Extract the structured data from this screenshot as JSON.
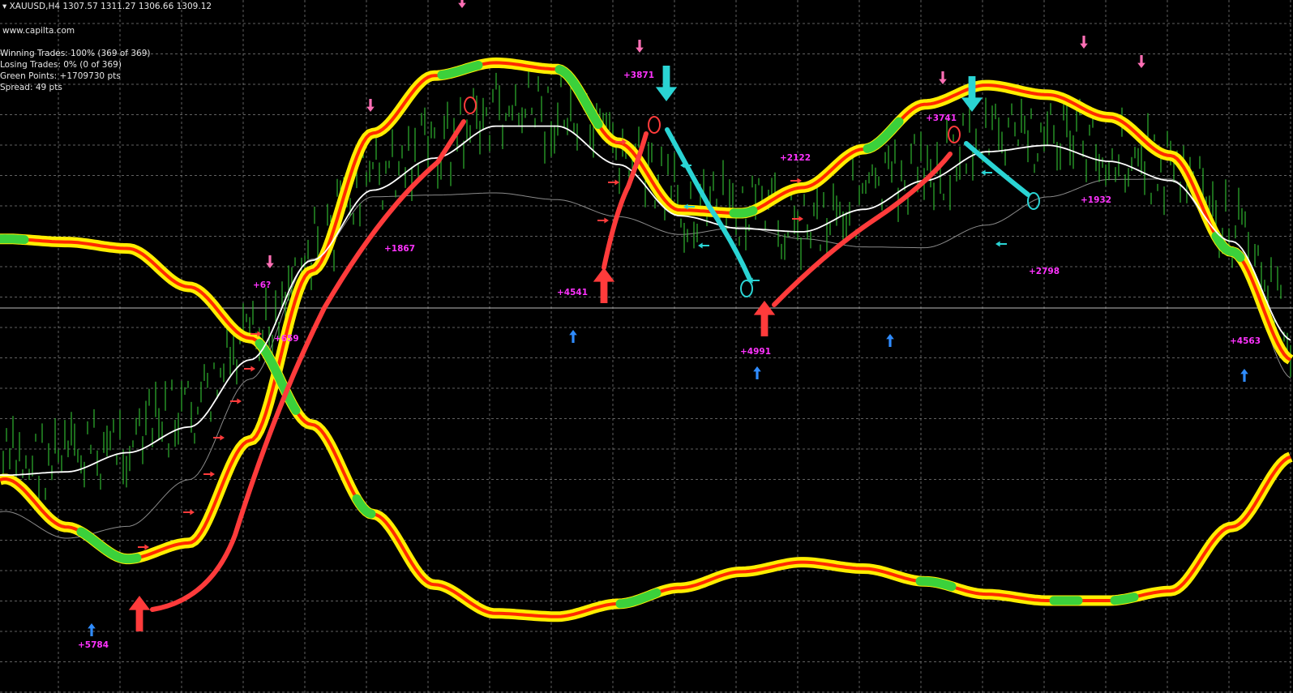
{
  "header": {
    "symbol_line": "▾ XAUUSD,H4  1307.57 1311.27 1306.66 1309.12",
    "website": "www.capilta.com"
  },
  "stats": {
    "winning": "Winning Trades: 100% (369 of 369)",
    "losing": "Losing Trades: 0% (0 of 369)",
    "green_points": "Green Points: +1709730 pts",
    "spread": "Spread: 49 pts"
  },
  "colors": {
    "background": "#000000",
    "grid": "#8a8a8a",
    "candles": "#2fb52f",
    "band_outer": "#ffee00",
    "band_inner": "#ff2a00",
    "band_highlight": "#3bd13b",
    "middle_line": "#ffffff",
    "slow_line": "#8a8a8a",
    "profit_label": "#ff33ff",
    "buy_arrow": "#2f8cff",
    "sell_arrow": "#ff6fb5",
    "trend_up": "#ff3b3b",
    "trend_down": "#2ad4d4"
  },
  "chart_data": {
    "type": "line",
    "symbol": "XAUUSD",
    "timeframe": "H4",
    "ohlc": {
      "open": 1307.57,
      "high": 1311.27,
      "low": 1306.66,
      "close": 1309.12
    },
    "x": [
      0,
      1,
      2,
      3,
      4,
      5,
      6,
      7,
      8,
      9,
      10,
      11,
      12,
      13,
      14,
      15,
      16,
      17,
      18,
      19,
      20,
      21
    ],
    "series": [
      {
        "name": "",
        "values": [
          0.42,
          0.57,
          0.67,
          0.62,
          0.3,
          -0.23,
          -0.66,
          -0.84,
          -0.88,
          -0.86,
          -0.63,
          -0.42,
          -0.41,
          -0.49,
          -0.61,
          -0.75,
          -0.81,
          -0.78,
          -0.71,
          -0.59,
          -0.29,
          0.05
        ]
      },
      {
        "name": "",
        "values": [
          -0.33,
          -0.32,
          -0.3,
          -0.18,
          -0.02,
          0.25,
          0.53,
          0.75,
          0.84,
          0.85,
          0.81,
          0.76,
          0.71,
          0.68,
          0.7,
          0.74,
          0.78,
          0.8,
          0.8,
          0.77,
          0.57,
          0.35
        ]
      },
      {
        "name": "",
        "values": [
          0.37,
          0.36,
          0.3,
          0.22,
          0.01,
          -0.3,
          -0.52,
          -0.62,
          -0.72,
          -0.72,
          -0.6,
          -0.44,
          -0.4,
          -0.39,
          -0.46,
          -0.55,
          -0.64,
          -0.66,
          -0.61,
          -0.55,
          -0.36,
          -0.05
        ]
      }
    ],
    "profit_labels": [
      "+5784",
      "+659",
      "+6?",
      "+1867",
      "+4541",
      "+3871",
      "+4991",
      "+2122",
      "+3741",
      "+2798",
      "+1932",
      "+4563"
    ],
    "grid": true
  }
}
